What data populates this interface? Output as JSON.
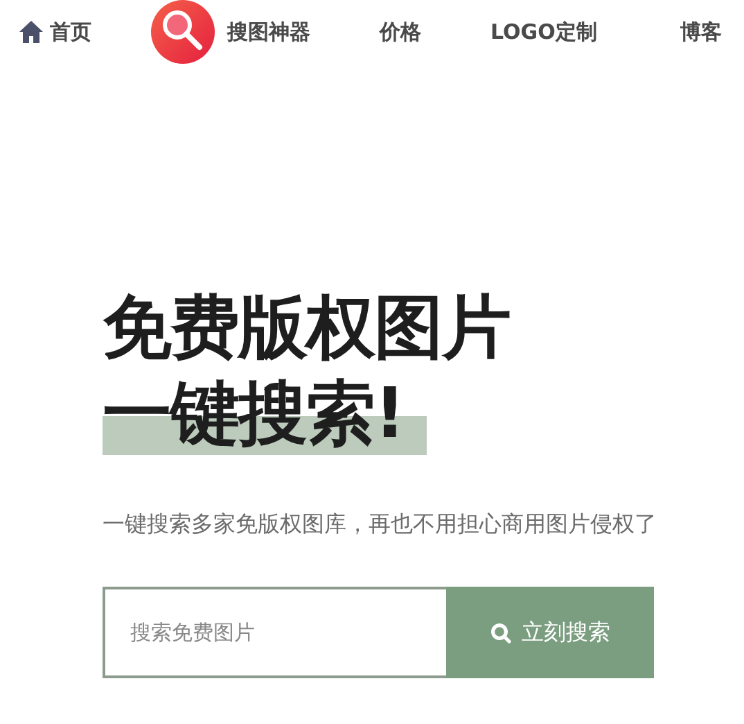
{
  "nav": {
    "items": [
      {
        "label": "首页",
        "kind": "home"
      },
      {
        "label": "搜图神器",
        "kind": "logo"
      },
      {
        "label": "价格",
        "kind": "text"
      },
      {
        "label": "LOGO定制",
        "kind": "text"
      },
      {
        "label": "博客",
        "kind": "text"
      }
    ]
  },
  "hero": {
    "title_line_1": "免费版权图片",
    "title_line_2": "一键搜索!",
    "subtitle": "一键搜索多家免版权图库，再也不用担心商用图片侵权了"
  },
  "search": {
    "placeholder": "搜索免费图片",
    "button": "立刻搜索"
  }
}
